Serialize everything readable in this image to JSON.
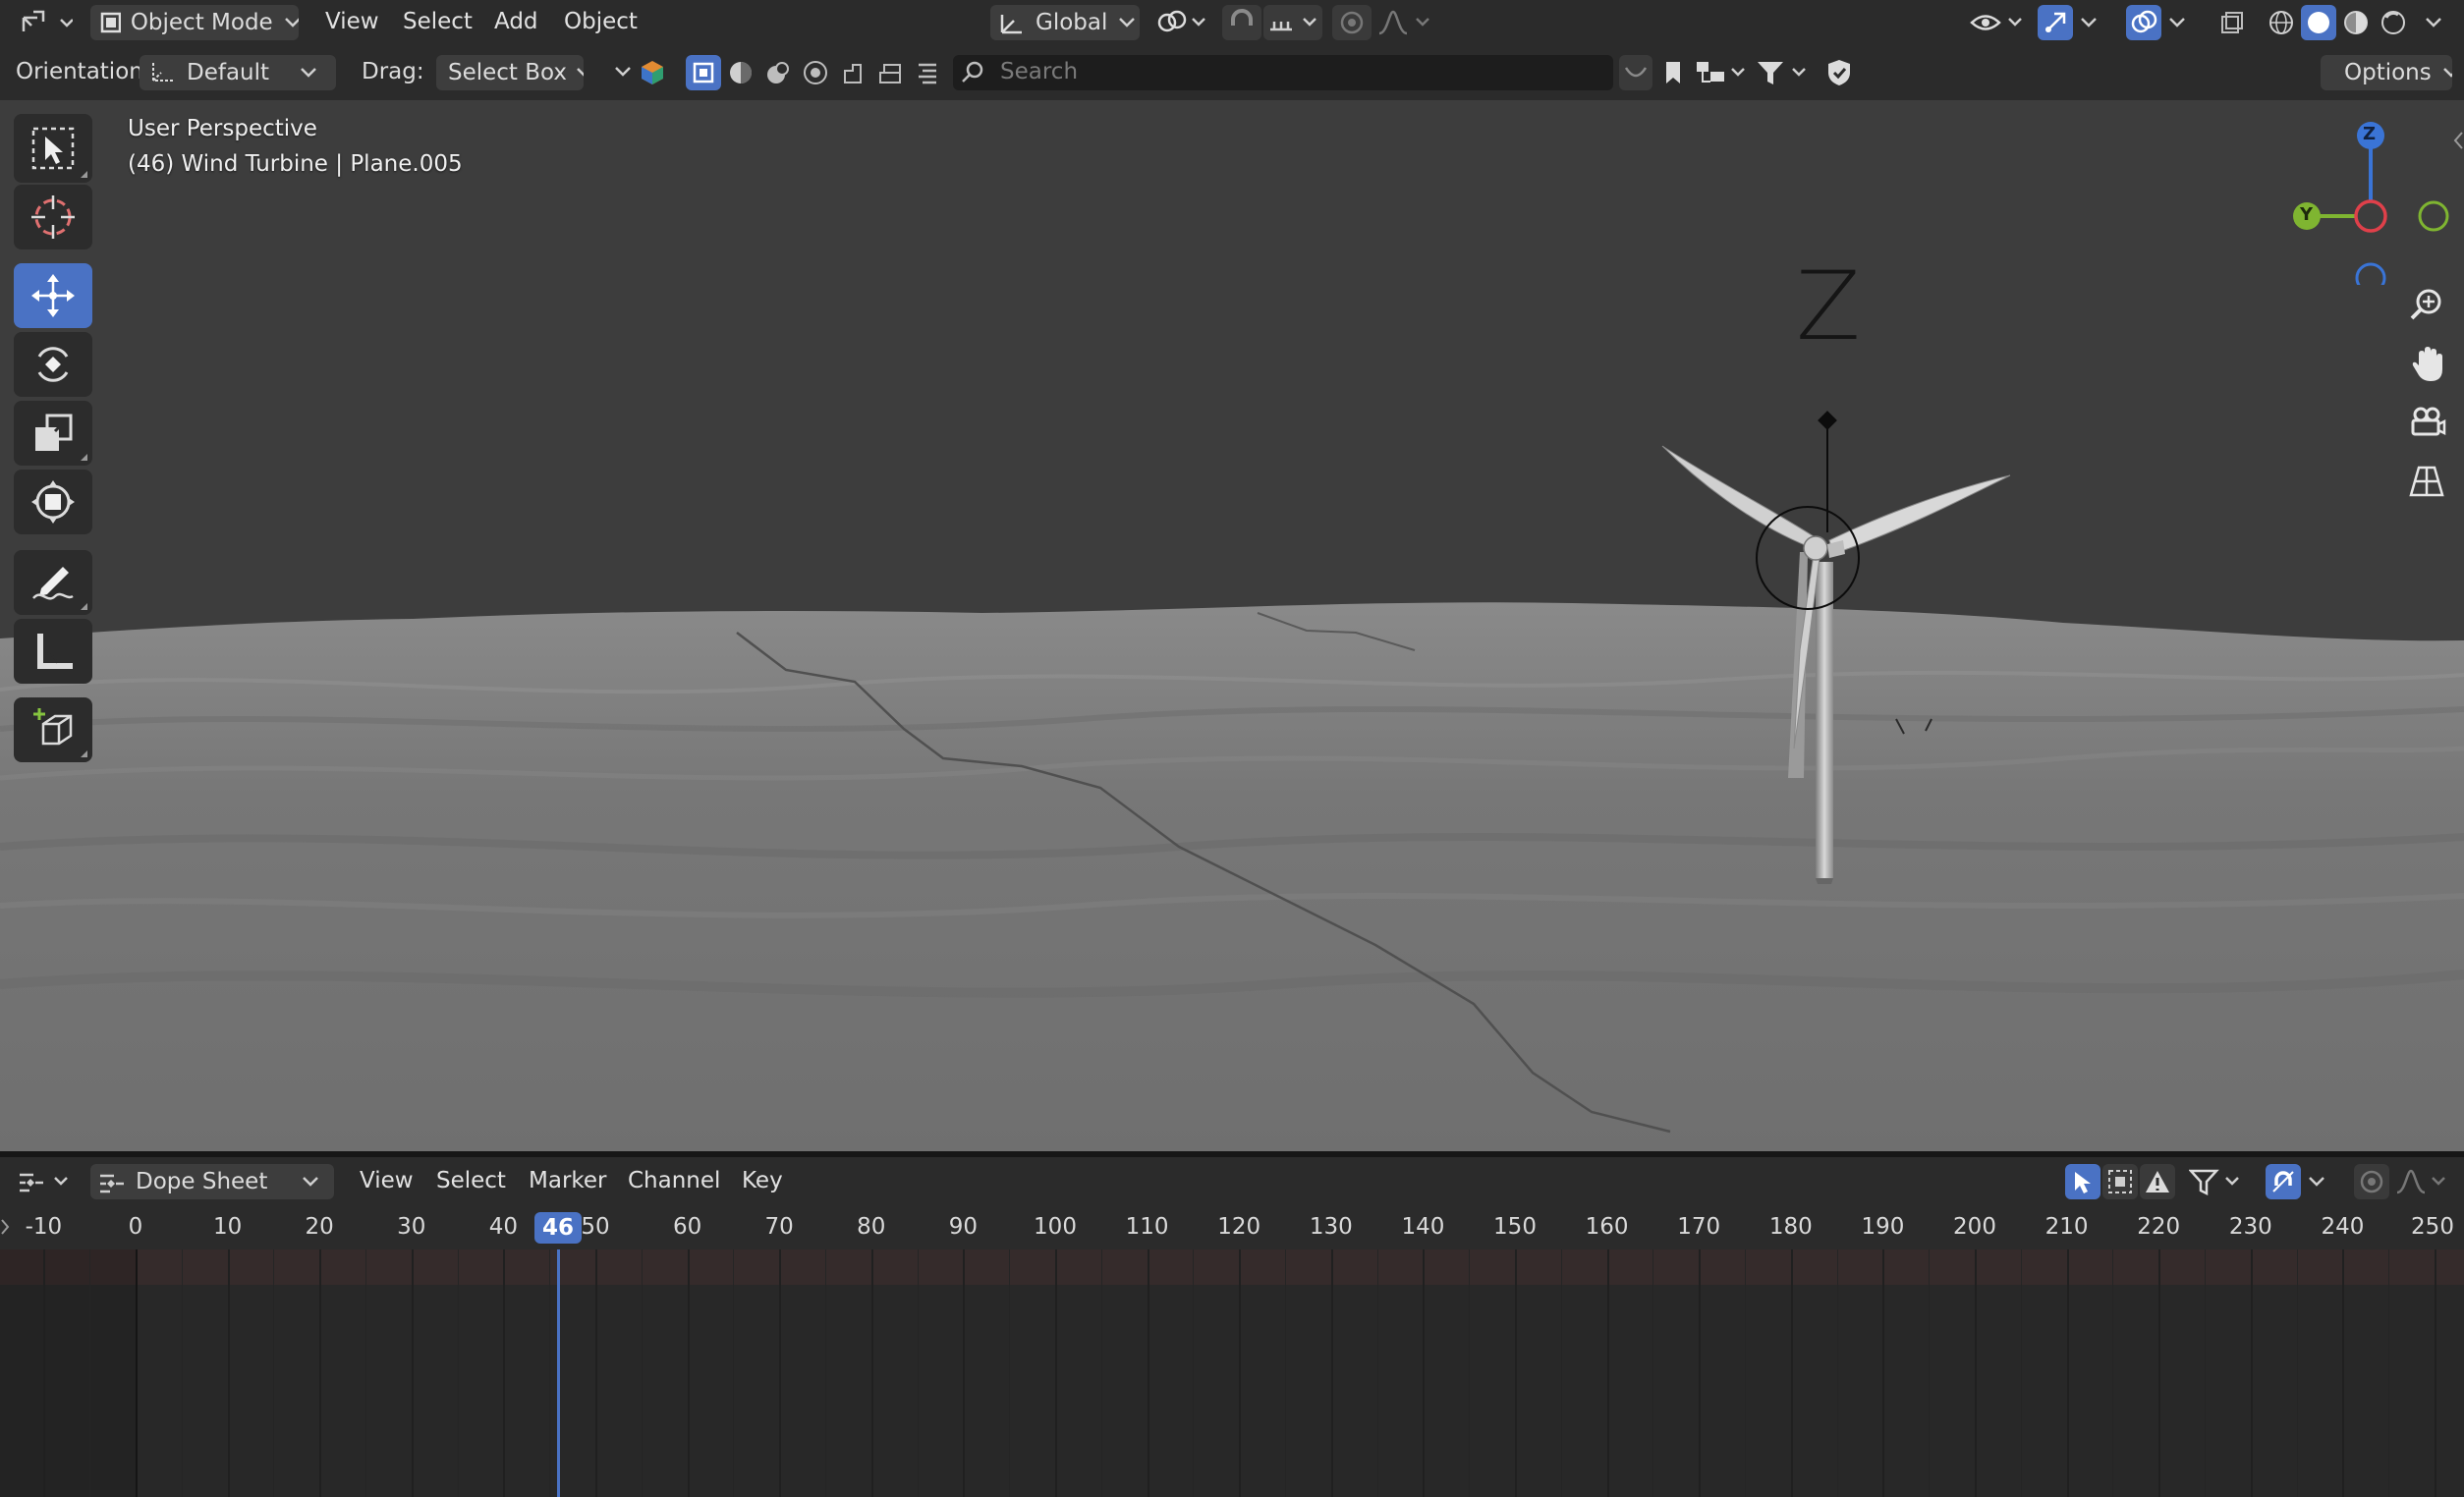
{
  "top_header": {
    "editor_type_icon": "editor-type-3d-icon",
    "mode": "Object Mode",
    "menus": [
      "View",
      "Select",
      "Add",
      "Object"
    ],
    "transform_orientation": "Global",
    "options_label": "Options"
  },
  "tool_header": {
    "orientation_label": "Orientation:",
    "orientation_value": "Default",
    "drag_label": "Drag:",
    "drag_value": "Select Box",
    "search_placeholder": "Search"
  },
  "viewport": {
    "view_name": "User Perspective",
    "object_info": "(46) Wind Turbine | Plane.005",
    "axis_label": "Z",
    "gizmo": {
      "z": "Z",
      "y": "Y"
    },
    "colors": {
      "background": "#3d3d3d",
      "terrain": "#7a7a7a",
      "active_tool": "#4a72c4",
      "axis_x": "#e0404a",
      "axis_y": "#7fb531",
      "axis_z": "#3a74d6"
    }
  },
  "dope_sheet": {
    "editor_type": "Dope Sheet",
    "menus": [
      "View",
      "Select",
      "Marker",
      "Channel",
      "Key"
    ],
    "current_frame": "46",
    "ticks": [
      "-10",
      "0",
      "10",
      "20",
      "30",
      "40",
      "50",
      "60",
      "70",
      "80",
      "90",
      "100",
      "110",
      "120",
      "130",
      "140",
      "150",
      "160",
      "170",
      "180",
      "190",
      "200",
      "210",
      "220",
      "230",
      "240",
      "250"
    ],
    "current_frame_color": "#4a72c4"
  }
}
